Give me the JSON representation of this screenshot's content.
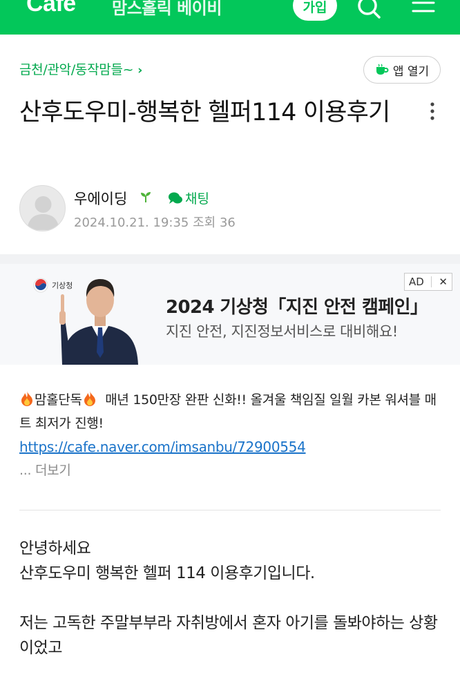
{
  "header": {
    "logo": "Cafe",
    "cafe_name": "맘스홀릭 베이비",
    "join_label": "가입",
    "icons": [
      "search-icon",
      "menu-icon"
    ],
    "brand_color": "#03c75a"
  },
  "board": {
    "breadcrumb": "금천/관악/동작맘들~",
    "app_open_label": "앱 열기"
  },
  "post": {
    "title": "산후도우미-행복한 헬퍼114 이용후기",
    "author": "우에이딩",
    "chat_label": "채팅",
    "meta": "2024.10.21. 19:35  조회 36"
  },
  "ad": {
    "org": "기상청",
    "title": "2024 기상청「지진 안전 캠페인」",
    "subtitle": "지진 안전, 지진정보서비스로 대비해요!",
    "badge": "AD",
    "close": "✕"
  },
  "notice": {
    "tag": "맘홀단독",
    "text": "매년 150만장 완판 신화!! 올겨울 책임질 일월 카본 워셔블 매트 최저가 진행!",
    "link": "https://cafe.naver.com/imsanbu/72900554",
    "more": "... 더보기"
  },
  "content": {
    "line1": "안녕하세요",
    "line2": "산후도우미 행복한 헬퍼 114 이용후기입니다.",
    "line3": "저는 고독한 주말부부라 자취방에서 혼자 아기를 돌봐야하는 상황이었고"
  }
}
